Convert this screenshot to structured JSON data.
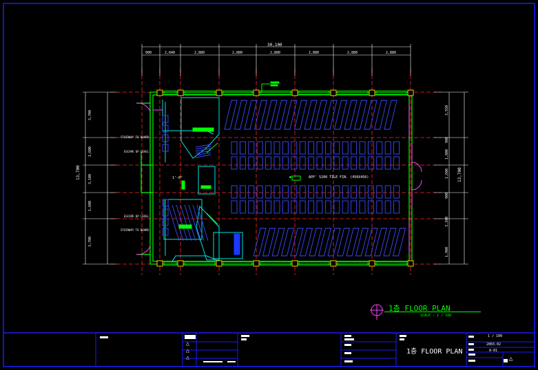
{
  "drawing": {
    "overall_dimension": "30,100",
    "top_dimensions": [
      "900",
      "2,640",
      "2,880",
      "2,880",
      "2,880",
      "2,880",
      "2,880",
      "2,880"
    ],
    "left_dimensions": [
      "3,700",
      "1,600",
      "3,100",
      "1,600",
      "3,700"
    ],
    "left_total": "13,700",
    "right_dimensions": [
      "3,550",
      "900",
      "1,800",
      "1,600",
      "900",
      "3,100",
      "1,900"
    ],
    "right_total": "13,700",
    "center_note": "APP' 5200 TILE FIN. (450X450)",
    "annotations": [
      "STAIRWAY TO BOARD",
      "STAIRWAY TO BOARD",
      "ESCAPE UP LEVEL",
      "ESCAPE UP LEVEL"
    ],
    "stair_label": "1'-0\""
  },
  "plan_title": {
    "label": "1층  FLOOR  PLAN",
    "scale": "SCALE : 1 / 100"
  },
  "title_block": {
    "sheet_title": "1층  FLOOR  PLAN",
    "scale_value": "1 / 100",
    "date_value": "2003.02",
    "sheet_number": "A-01",
    "revision_marks": [
      "△",
      "△",
      "△"
    ]
  },
  "colors": {
    "border": "#1a1aff",
    "wall": "#00ff00",
    "grid": "#ff2a2a",
    "seat": "#3b4bff",
    "stair": "#00e5e5",
    "column": "#ffd000",
    "door": "#ff40ff",
    "text": "#ffffff"
  }
}
